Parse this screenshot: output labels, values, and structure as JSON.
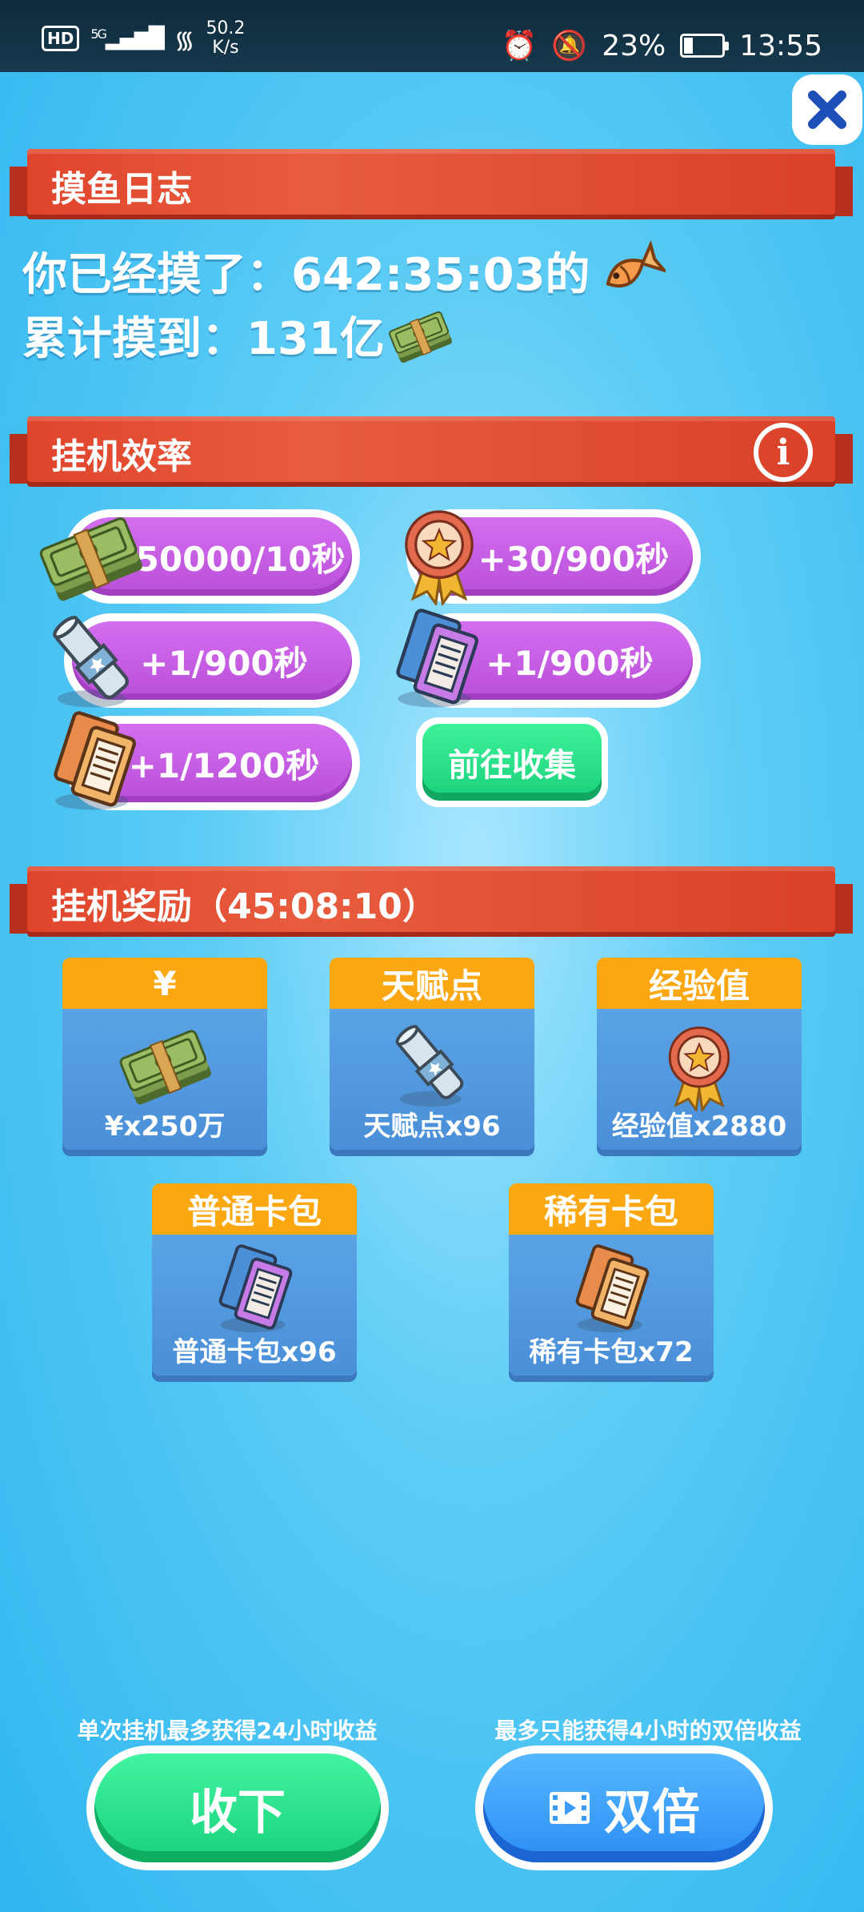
{
  "status_bar": {
    "network": "5G",
    "speed_value": "50.2",
    "speed_unit": "K/s",
    "battery": "23%",
    "time": "13:55"
  },
  "fishing_log": {
    "title": "摸鱼日志",
    "time_line": "你已经摸了：642:35:03的",
    "total_line": "累计摸到：131亿"
  },
  "efficiency": {
    "title": "挂机效率",
    "items": [
      {
        "icon": "cash-icon",
        "label": "+50000/10秒"
      },
      {
        "icon": "medal-icon",
        "label": "+30/900秒"
      },
      {
        "icon": "scroll-icon",
        "label": "+1/900秒"
      },
      {
        "icon": "blue-ticket-icon",
        "label": "+1/900秒"
      },
      {
        "icon": "orange-ticket-icon",
        "label": "+1/1200秒"
      }
    ],
    "goto_label": "前往收集"
  },
  "rewards": {
    "title": "挂机奖励（45:08:10）",
    "cards": [
      {
        "head": "¥",
        "label": "¥x250万",
        "icon": "cash-icon"
      },
      {
        "head": "天赋点",
        "label": "天赋点x96",
        "icon": "scroll-icon"
      },
      {
        "head": "经验值",
        "label": "经验值x2880",
        "icon": "medal-icon"
      },
      {
        "head": "普通卡包",
        "label": "普通卡包x96",
        "icon": "card-pack-icon"
      },
      {
        "head": "稀有卡包",
        "label": "稀有卡包x72",
        "icon": "rare-card-pack-icon"
      }
    ]
  },
  "bottom": {
    "note_left": "单次挂机最多获得24小时收益",
    "note_right": "最多只能获得4小时的双倍收益",
    "collect_label": "收下",
    "double_label": "双倍"
  },
  "colors": {
    "ribbon": "#e0452c",
    "pill": "#c45fe0",
    "card_head": "#fba712",
    "card_body": "#5aa3e6",
    "green_button": "#1fd780",
    "blue_button": "#3a9cf8"
  }
}
